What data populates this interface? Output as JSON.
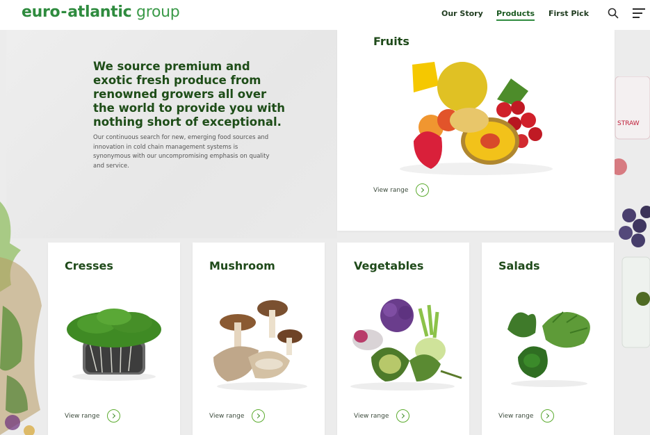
{
  "header": {
    "logo": {
      "part1": "euro",
      "dash": "-",
      "part2": "atlantic",
      "part3": "group"
    },
    "nav": [
      {
        "label": "Our Story",
        "active": false
      },
      {
        "label": "Products",
        "active": true
      },
      {
        "label": "First Pick",
        "active": false
      }
    ],
    "icons": [
      "search-icon",
      "menu-icon"
    ]
  },
  "intro": {
    "heading": "We source premium and exotic fresh produce from renowned growers all over the world to provide you with nothing short of exceptional.",
    "body": "Our continuous search for new, emerging food sources and innovation in cold chain management systems is synonymous with our uncompromising emphasis on quality and service."
  },
  "cards": {
    "fruits": {
      "title": "Fruits",
      "cta": "View range"
    },
    "cresses": {
      "title": "Cresses",
      "cta": "View range"
    },
    "mushroom": {
      "title": "Mushroom",
      "cta": "View range"
    },
    "vegetables": {
      "title": "Vegetables",
      "cta": "View range"
    },
    "salads": {
      "title": "Salads",
      "cta": "View range"
    }
  },
  "colors": {
    "brand_green": "#2e8b3e",
    "title_green": "#1f4a1a",
    "accent_lime": "#5bab2e"
  }
}
